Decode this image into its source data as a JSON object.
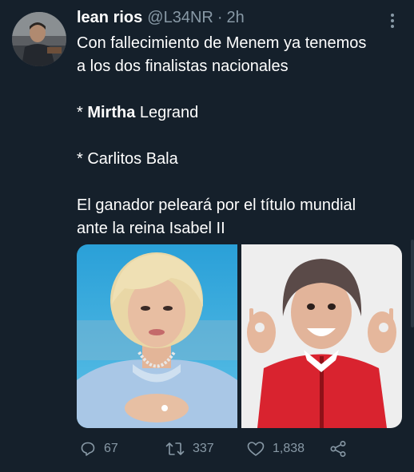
{
  "tweet": {
    "author_name": "lean rios",
    "author_handle": "@L34NR",
    "separator": "·",
    "time_ago": "2h",
    "text_line1": "Con fallecimiento de Menem ya tenemos",
    "text_line2": "a los dos finalistas nacionales",
    "bullet1_prefix": "* ",
    "bullet1_bold": "Mirtha",
    "bullet1_rest": " Legrand",
    "bullet2": "* Carlitos Bala",
    "text_line5": "El ganador peleará por el título mundial",
    "text_line6": "ante la reina Isabel II"
  },
  "media": {
    "left_image": "photo-woman-blonde-hair-blue-dress",
    "right_image": "photo-man-red-jacket-ok-gesture"
  },
  "actions": {
    "replies": "67",
    "retweets": "337",
    "likes": "1,838"
  },
  "icons": {
    "reply": "reply-icon",
    "retweet": "retweet-icon",
    "like": "heart-icon",
    "share": "share-icon",
    "more": "more-icon"
  },
  "colors": {
    "background": "#15202b",
    "secondary_text": "#8899a6",
    "primary_text": "#ffffff"
  }
}
